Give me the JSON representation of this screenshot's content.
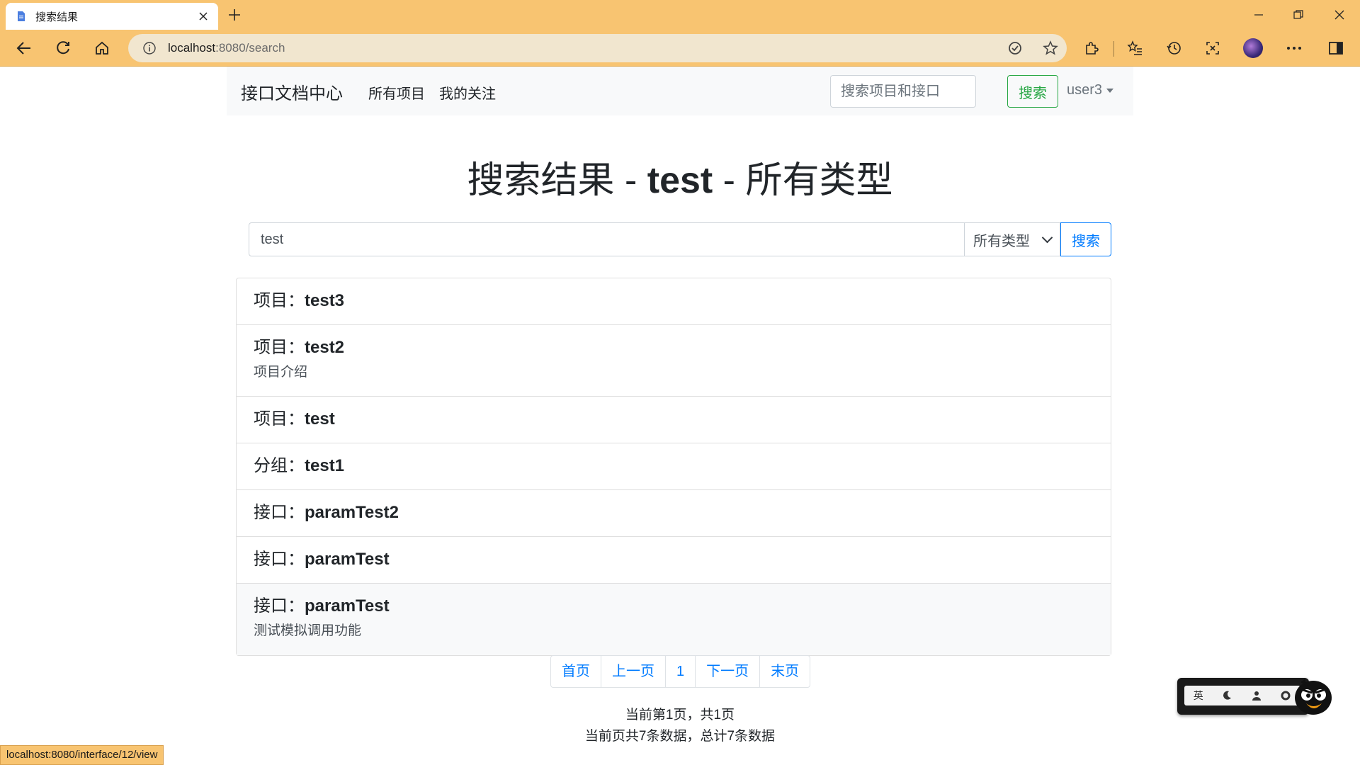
{
  "browser": {
    "tab_title": "搜索结果",
    "url_host": "localhost",
    "url_rest": ":8080/search",
    "status_url": "localhost:8080/interface/12/view",
    "accent_color": "#f8c471"
  },
  "navbar": {
    "brand": "接口文档中心",
    "links": [
      "所有项目",
      "我的关注"
    ],
    "search_placeholder": "搜索项目和接口",
    "search_button": "搜索",
    "user": "user3"
  },
  "heading": {
    "prefix": "搜索结果 - ",
    "keyword": "test",
    "suffix": " - 所有类型"
  },
  "search_form": {
    "query": "test",
    "type_selected": "所有类型",
    "button": "搜索"
  },
  "results": [
    {
      "kind": "项目：",
      "name": "test3",
      "desc": ""
    },
    {
      "kind": "项目：",
      "name": "test2",
      "desc": "项目介绍"
    },
    {
      "kind": "项目：",
      "name": "test",
      "desc": ""
    },
    {
      "kind": "分组：",
      "name": "test1",
      "desc": ""
    },
    {
      "kind": "接口：",
      "name": "paramTest2",
      "desc": ""
    },
    {
      "kind": "接口：",
      "name": "paramTest",
      "desc": ""
    },
    {
      "kind": "接口：",
      "name": "paramTest",
      "desc": "测试模拟调用功能"
    }
  ],
  "pagination": {
    "first": "首页",
    "prev": "上一页",
    "current": "1",
    "next": "下一页",
    "last": "末页"
  },
  "page_info": {
    "line1": "当前第1页，共1页",
    "line2": "当前页共7条数据，总计7条数据"
  },
  "widget": {
    "label": "英"
  }
}
